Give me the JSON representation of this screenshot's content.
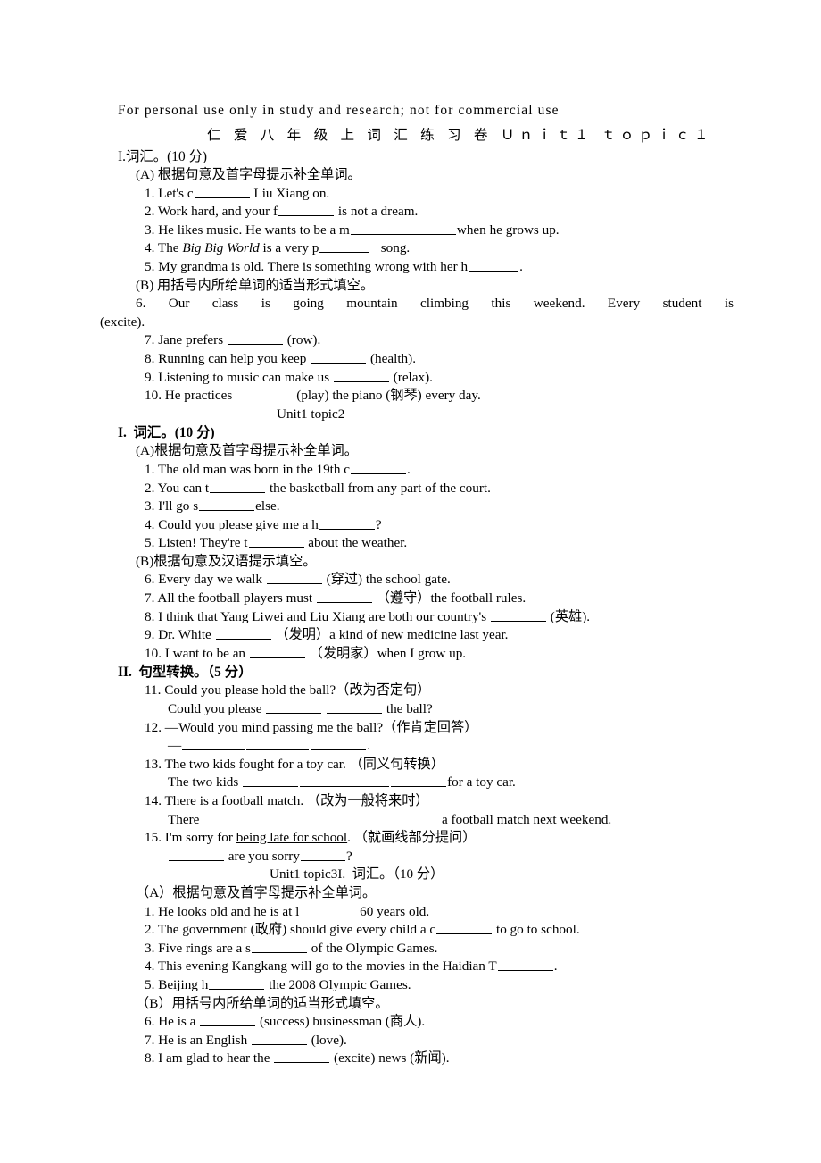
{
  "document": {
    "header_note": "For personal use only in study and research; not for commercial use",
    "title": "仁 爱 八 年 级 上 词 汇 练 习 卷 Ｕｎｉｔ１ ｔｏｐｉｃ１"
  },
  "topic1": {
    "section_heading": "I.词汇。(10 分)",
    "part_a_label": "(A) 根据句意及首字母提示补全单词。",
    "part_a_items": [
      {
        "num": "1.",
        "pre": "Let's c",
        "post": " Liu Xiang on."
      },
      {
        "num": "2.",
        "pre": "Work hard, and your f",
        "post": " is not a dream."
      },
      {
        "num": "3.",
        "pre": "He likes music. He wants to be a m",
        "post": "when he grows up."
      },
      {
        "num": "4.",
        "pre_plain": "The ",
        "italic": "Big Big World",
        "pre2": " is a very p",
        "post": "   song."
      },
      {
        "num": "5.",
        "pre": "My grandma is old. There is something wrong with her h",
        "post": "."
      }
    ],
    "part_b_label": "(B) 用括号内所给单词的适当形式填空。",
    "item6_text": "6.  Our  class  is  going  mountain  climbing  this  weekend.  Every  student  is",
    "item6_tail": "(excite).",
    "part_b_items": [
      {
        "num": "7.",
        "pre": "Jane prefers ",
        "post": " (row)."
      },
      {
        "num": "8.",
        "pre": "Running can help you keep ",
        "post": " (health)."
      },
      {
        "num": "9.",
        "pre": "Listening to music can make us ",
        "post": " (relax)."
      },
      {
        "num": "10.",
        "pre": "He practices",
        "post": "(play) the piano (钢琴) every day."
      }
    ]
  },
  "topic2": {
    "divider": "Unit1 topic2",
    "section_heading": "I.  词汇。(10 分)",
    "part_a_label": "(A)根据句意及首字母提示补全单词。",
    "part_a_items": [
      {
        "num": "1.",
        "pre": "The old man was born in the 19th c",
        "post": "."
      },
      {
        "num": "2.",
        "pre": "You can t",
        "post": " the basketball from any part of the court."
      },
      {
        "num": "3.",
        "pre": "I'll go s",
        "post": "else."
      },
      {
        "num": "4.",
        "pre": "Could you please give me a h",
        "post": "?"
      },
      {
        "num": "5.",
        "pre": "Listen! They're t",
        "post": " about the weather."
      }
    ],
    "part_b_label": "(B)根据句意及汉语提示填空。",
    "part_b_items": [
      {
        "num": "6.",
        "pre": "Every day we walk ",
        "post": " (穿过) the school gate."
      },
      {
        "num": "7.",
        "pre": "All the football players must ",
        "post": " （遵守）the football rules."
      },
      {
        "num": "8.",
        "pre": "I think that Yang Liwei and Liu Xiang are both our country's ",
        "post": " (英雄)."
      },
      {
        "num": "9.",
        "pre": "Dr. White ",
        "post": " （发明）a kind of new medicine last year."
      },
      {
        "num": "10.",
        "pre": "I want to be an ",
        "post": " （发明家）when I grow up."
      }
    ],
    "section2_heading": "II.  句型转换。（5 分）",
    "transform_items": [
      {
        "num": "11.",
        "prompt": "Could you please hold the ball?（改为否定句）",
        "answer_pre": "Could you please ",
        "answer_mid": " ",
        "answer_post": " the ball?"
      },
      {
        "num": "12.",
        "prompt": "—Would you mind passing me the ball?（作肯定回答）",
        "answer_pre": "—",
        "answer_post": "."
      },
      {
        "num": "13.",
        "prompt": "The two kids fought for a toy car. （同义句转换）",
        "answer_pre": "The two kids ",
        "answer_post": "for a toy car."
      },
      {
        "num": "14.",
        "prompt": "There is a football match. （改为一般将来时）",
        "answer_pre": "There ",
        "answer_post": " a football match next weekend."
      },
      {
        "num": "15.",
        "prompt_pre": "I'm sorry for ",
        "prompt_underlined": "being late for school",
        "prompt_post": ". （就画线部分提问）",
        "answer_mid": " are you sorry",
        "answer_post": "?"
      }
    ]
  },
  "topic3": {
    "divider": "Unit1 topic3I.  词汇。（10 分）",
    "part_a_label": "（A）根据句意及首字母提示补全单词。",
    "part_a_items": [
      {
        "num": "1.",
        "pre": "He looks old and he is at l",
        "post": " 60 years old."
      },
      {
        "num": "2.",
        "pre": "The government (政府) should give every child a c",
        "post": " to go to school."
      },
      {
        "num": "3.",
        "pre": "Five rings are a s",
        "post": " of the Olympic Games."
      },
      {
        "num": "4.",
        "pre": "This evening Kangkang will go to the movies in the Haidian T",
        "post": "."
      },
      {
        "num": "5.",
        "pre": "Beijing h",
        "post": " the 2008 Olympic Games."
      }
    ],
    "part_b_label": "（B）用括号内所给单词的适当形式填空。",
    "part_b_items": [
      {
        "num": "6.",
        "pre": "He is a ",
        "post": " (success) businessman (商人)."
      },
      {
        "num": "7.",
        "pre": "He is an English ",
        "post": " (love)."
      },
      {
        "num": "8.",
        "pre": "I am glad to hear the ",
        "post": " (excite) news (新闻)."
      }
    ]
  },
  "colors": {
    "page_background": "#ffffff",
    "text": "#000000"
  }
}
